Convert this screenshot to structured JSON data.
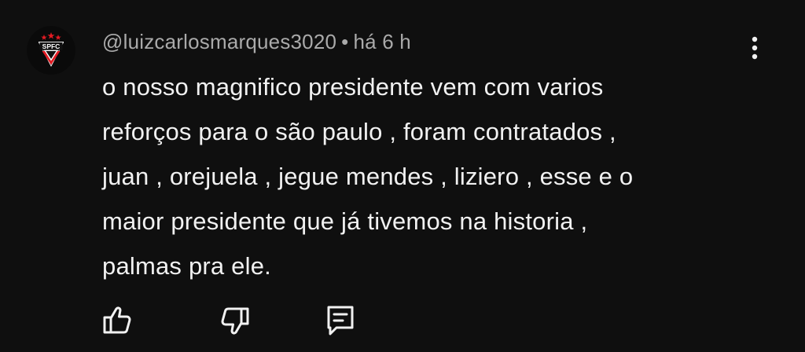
{
  "comment": {
    "author_handle": "@luizcarlosmarques3020",
    "separator": "•",
    "time_ago": "há 6 h",
    "avatar": {
      "icon": "spfc-crest-icon",
      "crest_text": "SPFC",
      "colors": {
        "red": "#e31b23",
        "black": "#000000",
        "white": "#ffffff"
      }
    },
    "text_lines": [
      "o nosso magnifico presidente vem com varios",
      "reforços para o são paulo , foram contratados ,",
      "juan , orejuela , jegue mendes , liziero , esse e o",
      "maior presidente que já tivemos na historia ,",
      "palmas pra ele."
    ],
    "actions": {
      "like_icon": "thumbs-up-icon",
      "dislike_icon": "thumbs-down-icon",
      "reply_icon": "reply-comment-icon",
      "more_icon": "more-vertical-icon"
    }
  },
  "theme": {
    "background": "#0f0f0f",
    "text_primary": "#f1f1f1",
    "text_secondary": "#aaaaaa"
  }
}
